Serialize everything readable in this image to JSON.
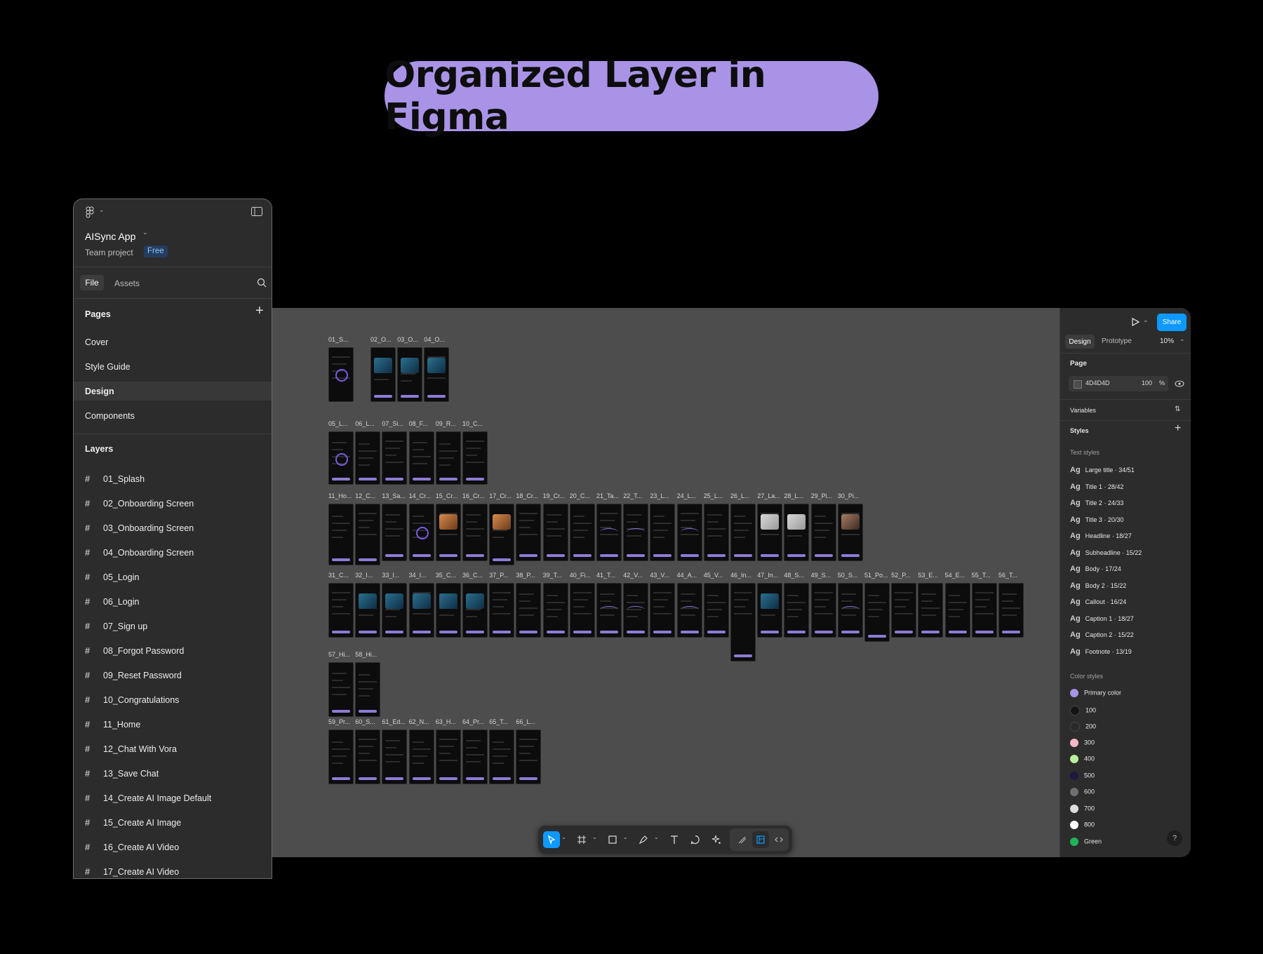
{
  "headline": "Organized Layer in Figma",
  "left_panel": {
    "file_name": "AISync App",
    "team": "Team project",
    "plan_badge": "Free",
    "tabs": [
      "File",
      "Assets"
    ],
    "pages_title": "Pages",
    "pages": [
      "Cover",
      "Style Guide",
      "Design",
      "Components"
    ],
    "active_page": "Design",
    "layers_title": "Layers",
    "layers": [
      "01_Splash",
      "02_Onboarding Screen",
      "03_Onboarding Screen",
      "04_Onboarding Screen",
      "05_Login",
      "06_Login",
      "07_Sign up",
      "08_Forgot Password",
      "09_Reset Password",
      "10_Congratulations",
      "11_Home",
      "12_Chat With Vora",
      "13_Save Chat",
      "14_Create AI Image Default",
      "15_Create AI Image",
      "16_Create AI Video",
      "17_Create AI Video"
    ]
  },
  "canvas": {
    "background": "#4D4D4D",
    "rows": [
      [
        "01_S...",
        "02_O...",
        "03_O...",
        "04_O..."
      ],
      [
        "05_L...",
        "06_L...",
        "07_Si...",
        "08_F...",
        "09_R...",
        "10_C..."
      ],
      [
        "11_Ho...",
        "12_C...",
        "13_Sa...",
        "14_Cr...",
        "15_Cr...",
        "16_Cr...",
        "17_Cr...",
        "18_Cr...",
        "19_Cr...",
        "20_C...",
        "21_Ta...",
        "22_T...",
        "23_L...",
        "24_L...",
        "25_L...",
        "26_L...",
        "27_La...",
        "28_L...",
        "29_Pi...",
        "30_Pi..."
      ],
      [
        "31_C...",
        "32_I...",
        "33_I...",
        "34_I...",
        "35_C...",
        "36_C...",
        "37_P...",
        "38_P...",
        "39_T...",
        "40_Fi...",
        "41_T...",
        "42_V...",
        "43_V...",
        "44_A...",
        "45_V...",
        "46_In...",
        "47_In...",
        "48_S...",
        "49_S...",
        "50_S...",
        "51_Po...",
        "52_P...",
        "53_E...",
        "54_E...",
        "55_T...",
        "56_T..."
      ],
      [
        "57_Hi...",
        "58_Hi..."
      ],
      [
        "59_Pr...",
        "60_S...",
        "61_Ed...",
        "62_N...",
        "63_H...",
        "64_Pr...",
        "65_T...",
        "66_L..."
      ]
    ]
  },
  "right_panel": {
    "share_label": "Share",
    "tabs": [
      "Design",
      "Prototype"
    ],
    "zoom": "10%",
    "page_title": "Page",
    "page_color": "4D4D4D",
    "page_opacity": "100",
    "percent": "%",
    "variables": "Variables",
    "styles": "Styles",
    "text_styles_title": "Text styles",
    "text_styles": [
      {
        "name": "Large title",
        "spec": "34/51"
      },
      {
        "name": "Title 1",
        "spec": "28/42"
      },
      {
        "name": "Title 2",
        "spec": "24/33"
      },
      {
        "name": "Title 3",
        "spec": "20/30"
      },
      {
        "name": "Headline",
        "spec": "18/27"
      },
      {
        "name": "Subheadline",
        "spec": "15/22"
      },
      {
        "name": "Body",
        "spec": "17/24"
      },
      {
        "name": "Body 2",
        "spec": "15/22"
      },
      {
        "name": "Callout",
        "spec": "16/24"
      },
      {
        "name": "Caption 1",
        "spec": "18/27"
      },
      {
        "name": "Caption 2",
        "spec": "15/22"
      },
      {
        "name": "Footnote",
        "spec": "13/19"
      }
    ],
    "ag": "Ag",
    "color_styles_title": "Color styles",
    "color_styles": [
      {
        "name": "Primary color",
        "color": "#a993e6"
      },
      {
        "name": "100",
        "color": "#141414"
      },
      {
        "name": "200",
        "color": "#2a2a2a"
      },
      {
        "name": "300",
        "color": "#f5b8c6"
      },
      {
        "name": "400",
        "color": "#b9ef9c"
      },
      {
        "name": "500",
        "color": "#1c1a40"
      },
      {
        "name": "600",
        "color": "#6e6e74"
      },
      {
        "name": "700",
        "color": "#dcdcdc"
      },
      {
        "name": "800",
        "color": "#ffffff"
      },
      {
        "name": "Green",
        "color": "#1fb45a"
      }
    ]
  },
  "toolbar": {
    "tools": [
      "move-tool",
      "frame-tool",
      "shape-tool",
      "pen-tool",
      "text-tool",
      "comment-tool",
      "actions-tool",
      "draw-mode",
      "design-mode",
      "dev-mode"
    ]
  },
  "colors": {
    "accent": "#A993E6",
    "share": "#0d99ff",
    "canvas": "#4D4D4D",
    "panel": "#2C2C2C"
  }
}
